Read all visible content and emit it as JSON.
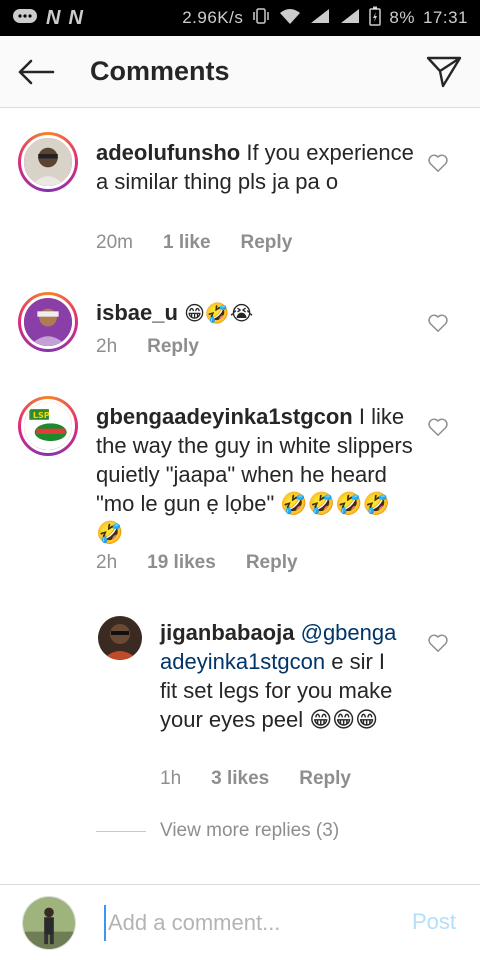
{
  "status_bar": {
    "speed": "2.96K/s",
    "battery": "8%",
    "time": "17:31",
    "icons": [
      "message-icon",
      "n-icon",
      "n-icon",
      "vibrate-icon",
      "wifi-icon",
      "signal-icon",
      "signal-icon",
      "battery-icon"
    ]
  },
  "header": {
    "title": "Comments"
  },
  "comments": [
    {
      "username": "adeolufunsho",
      "text": "If you experience a similar thing pls ja pa o",
      "time": "20m",
      "likes": "1 like",
      "reply": "Reply"
    },
    {
      "username": "isbae_u",
      "text": "😁🤣😭",
      "time": "2h",
      "reply": "Reply"
    },
    {
      "username": "gbengaadeyinka1stgcon",
      "text": "I like the way the guy in white slippers quietly \"jaapa\" when he heard \"mo le gun ẹ lọbe\" 🤣🤣🤣🤣🤣",
      "time": "2h",
      "likes": "19 likes",
      "reply": "Reply"
    },
    {
      "username": "jiganbabaoja",
      "mention": "@gbengaadeyinka1stgcon",
      "text": "e sir I fit set legs for you make your eyes peel 😁😁😁",
      "time": "1h",
      "likes": "3 likes",
      "reply": "Reply"
    }
  ],
  "view_more": "View more replies (3)",
  "composer": {
    "placeholder": "Add a comment...",
    "post": "Post"
  },
  "colors": {
    "link": "#003569",
    "post_disabled": "#b2dffc",
    "muted": "#8e8e8e"
  }
}
